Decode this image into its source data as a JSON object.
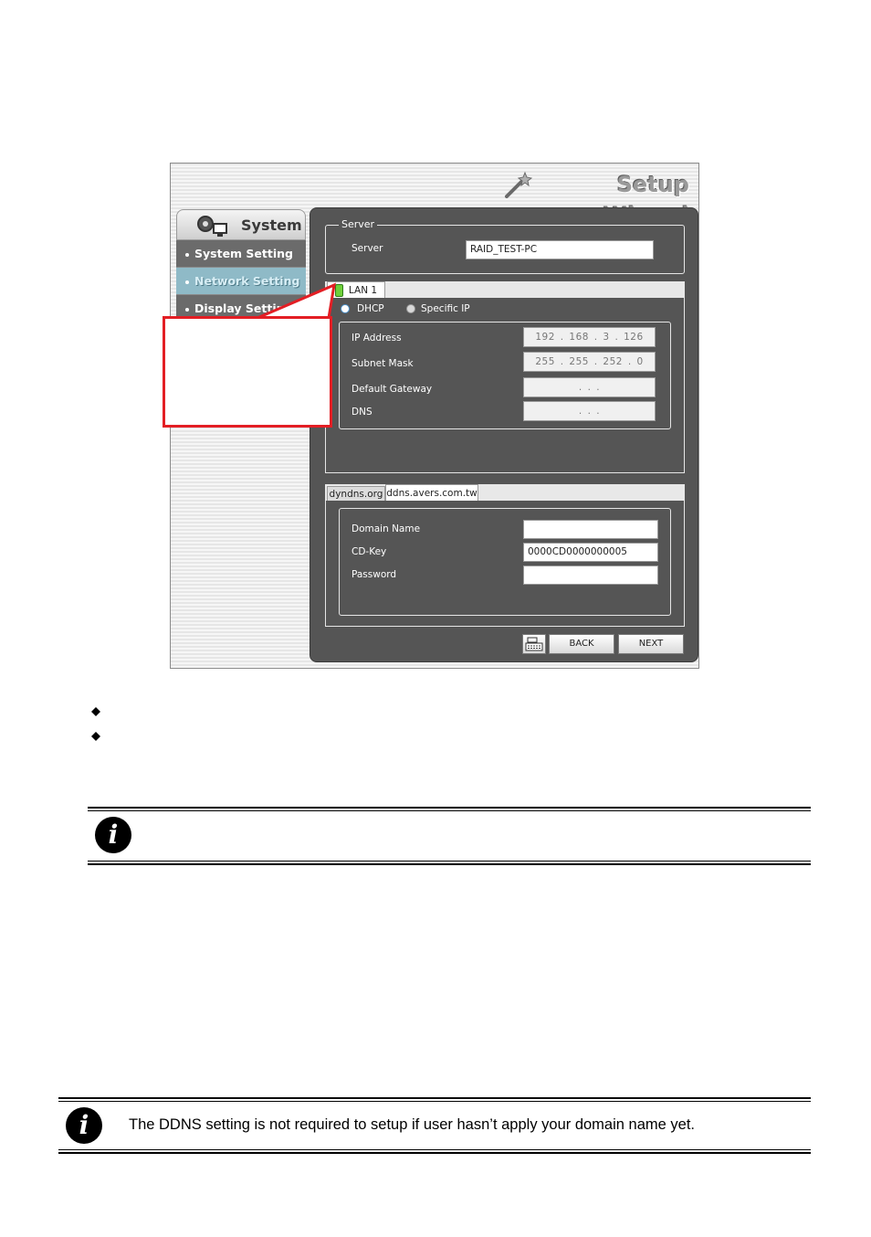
{
  "wizard": {
    "title": "Setup Wizard",
    "sidebar": {
      "header": "System",
      "items": [
        {
          "label": "System Setting"
        },
        {
          "label": "Network Setting"
        },
        {
          "label": "Display Setting"
        }
      ]
    },
    "server": {
      "legend": "Server",
      "label": "Server",
      "value": "RAID_TEST-PC"
    },
    "lan": {
      "tab_label": "LAN  1",
      "dhcp_label": "DHCP",
      "specific_ip_label": "Specific IP",
      "fields": [
        {
          "label": "IP Address",
          "value": "192  .  168  .   3   .  126"
        },
        {
          "label": "Subnet Mask",
          "value": "255  .  255  .  252  .   0"
        },
        {
          "label": "Default Gateway",
          "value": ".        .        ."
        },
        {
          "label": "DNS",
          "value": ".        .        ."
        }
      ]
    },
    "ddns": {
      "tabs": [
        {
          "label": "dyndns.org"
        },
        {
          "label": "ddns.avers.com.tw"
        }
      ],
      "fields": [
        {
          "label": "Domain Name",
          "value": ""
        },
        {
          "label": "CD-Key",
          "value": "0000CD0000000005"
        },
        {
          "label": "Password",
          "value": ""
        }
      ]
    },
    "buttons": {
      "back": "BACK",
      "next": "NEXT"
    }
  },
  "notes": {
    "note2": "The DDNS setting is not required to setup if user hasn’t apply your domain name yet."
  }
}
